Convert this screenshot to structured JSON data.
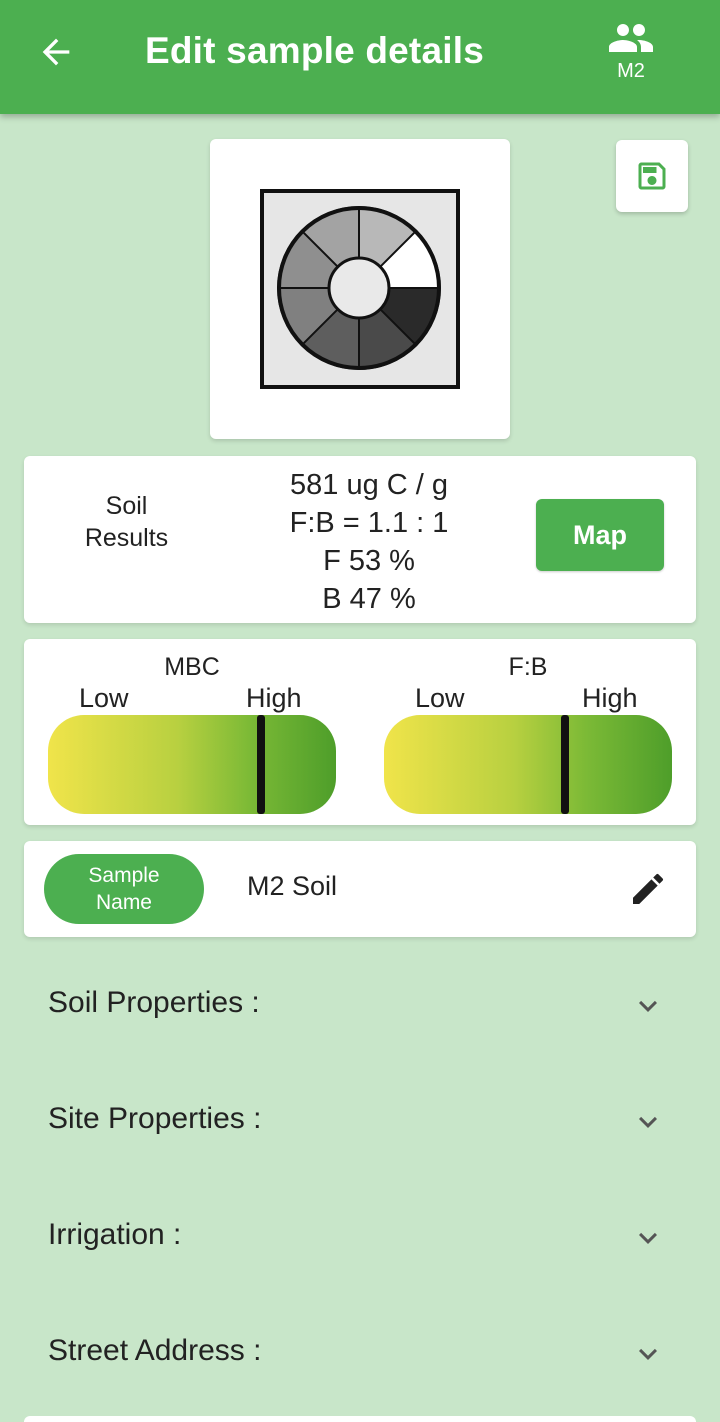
{
  "header": {
    "title": "Edit sample details",
    "group_label": "M2",
    "colors": {
      "appbar": "#4caf50",
      "accent": "#4caf50",
      "background": "#c8e6c9"
    }
  },
  "results": {
    "label_line1": "Soil",
    "label_line2": "Results",
    "mbc_value": "581 ug C / g",
    "fb_ratio": "F:B = 1.1 : 1",
    "fungi_pct": "F 53 %",
    "bacteria_pct": "B 47 %",
    "map_button": "Map"
  },
  "gauges": [
    {
      "name": "MBC",
      "low_label": "Low",
      "high_label": "High",
      "marker_fraction": 0.74
    },
    {
      "name": "F:B",
      "low_label": "Low",
      "high_label": "High",
      "marker_fraction": 0.63
    }
  ],
  "sample": {
    "pill_line1": "Sample",
    "pill_line2": "Name",
    "name": "M2 Soil"
  },
  "sections": [
    {
      "label": "Soil Properties :"
    },
    {
      "label": "Site Properties :"
    },
    {
      "label": "Irrigation :"
    },
    {
      "label": "Street Address :"
    }
  ],
  "icons": {
    "back": "arrow-back-icon",
    "group": "group-icon",
    "save": "save-icon",
    "edit": "pencil-icon",
    "expand": "chevron-down-icon",
    "sample_image": "soil-wheel-image"
  }
}
